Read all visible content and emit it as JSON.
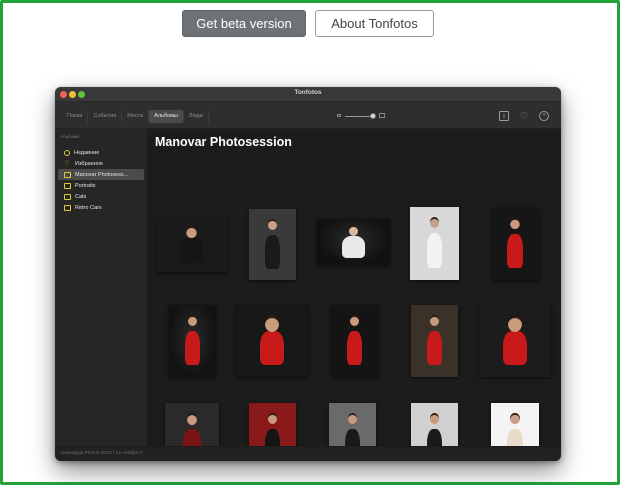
{
  "top_buttons": {
    "beta_label": "Get beta version",
    "about_label": "About Tonfotos"
  },
  "window": {
    "title": "Tonfotos",
    "tabs": [
      {
        "label": "Папки",
        "active": false
      },
      {
        "label": "События",
        "active": false
      },
      {
        "label": "Места",
        "active": false
      },
      {
        "label": "Альбомы",
        "active": true
      },
      {
        "label": "Люди",
        "active": false
      }
    ],
    "toolbar_icons": [
      "info-icon",
      "heart-icon",
      "plus-icon"
    ],
    "sidebar": {
      "heading": "Альбомы",
      "items": [
        {
          "label": "Недавние",
          "icon": "clock-icon",
          "selected": false
        },
        {
          "label": "Избранное",
          "icon": "heart-icon",
          "selected": false
        },
        {
          "label": "Manovar Photosess...",
          "icon": "album-icon",
          "selected": true
        },
        {
          "label": "Portraits",
          "icon": "album-icon",
          "selected": false
        },
        {
          "label": "Cats",
          "icon": "album-icon",
          "selected": false
        },
        {
          "label": "Retro Cars",
          "icon": "album-icon",
          "selected": false
        }
      ]
    },
    "album_title": "Manovar Photosession",
    "status_text": "Сканирую Photos 2023 \\ 14 ноября 2",
    "photos": [
      {
        "bg": "#1a1a1a",
        "skin": "#c99a7c",
        "outfit": "#151515"
      },
      {
        "bg": "#3a3a3a",
        "skin": "#caa088",
        "outfit": "#1a1a1a"
      },
      {
        "bg": "#111111",
        "skin": "#d8b8a0",
        "outfit": "#e8e8e8"
      },
      {
        "bg": "#d8d8d8",
        "skin": "#c8a08a",
        "outfit": "#f2f2f2"
      },
      {
        "bg": "#161616",
        "skin": "#c99a7c",
        "outfit": "#c81a1a"
      },
      {
        "bg": "#121212",
        "skin": "#c99a7c",
        "outfit": "#c81a1a"
      },
      {
        "bg": "#181818",
        "skin": "#c99a7c",
        "outfit": "#c81a1a"
      },
      {
        "bg": "#141414",
        "skin": "#c99a7c",
        "outfit": "#c81a1a"
      },
      {
        "bg": "#3a3228",
        "skin": "#c99a7c",
        "outfit": "#c81a1a"
      },
      {
        "bg": "#1c1c1c",
        "skin": "#c99a7c",
        "outfit": "#c81a1a"
      },
      {
        "bg": "#2a2a2a",
        "skin": "#c99a7c",
        "outfit": "#7a1414"
      },
      {
        "bg": "#8a1a1a",
        "skin": "#c99a7c",
        "outfit": "#151515"
      },
      {
        "bg": "#6a6a6a",
        "skin": "#c99a7c",
        "outfit": "#1a1a1a"
      },
      {
        "bg": "#d0d0d0",
        "skin": "#c99a7c",
        "outfit": "#1a1a1a"
      },
      {
        "bg": "#f4f4f4",
        "skin": "#c8a08a",
        "outfit": "#e8dcc8"
      }
    ]
  },
  "colors": {
    "frame_border": "#21a33b",
    "sidebar_icon_accent": "#d9cc35"
  }
}
